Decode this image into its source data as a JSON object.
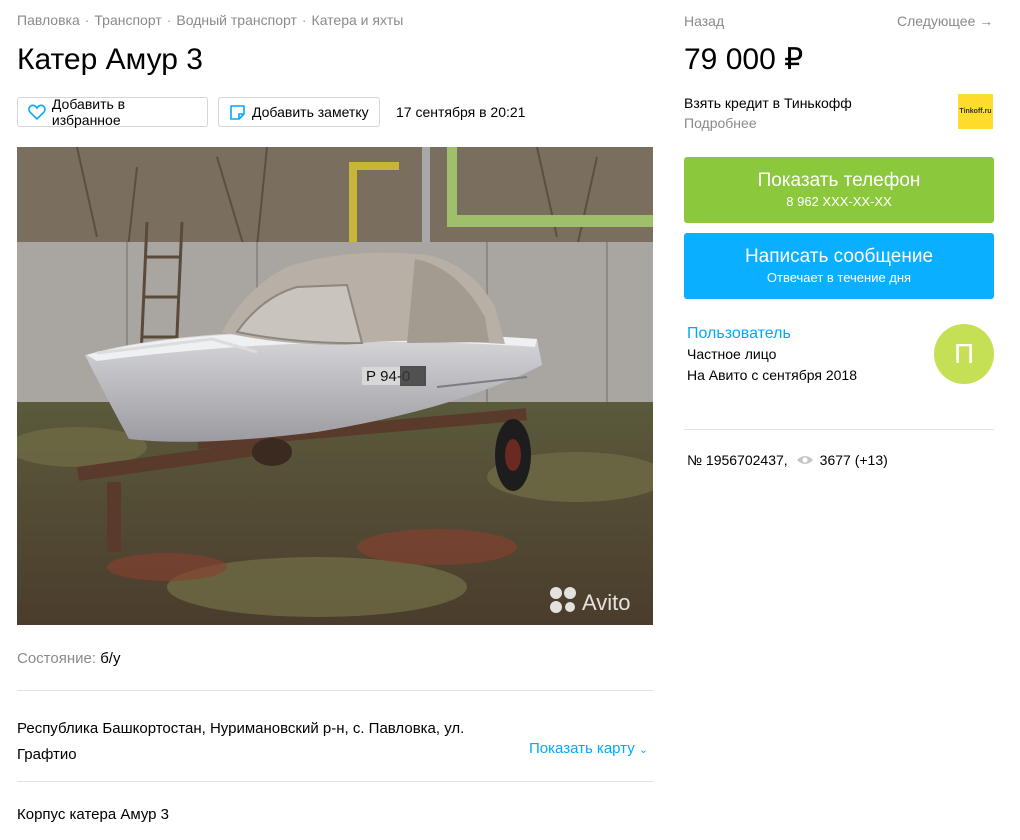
{
  "breadcrumbs": [
    "Павловка",
    "Транспорт",
    "Водный транспорт",
    "Катера и яхты"
  ],
  "breadcrumb_separator": "·",
  "title": "Катер Амур 3",
  "actions": {
    "favorite_label": "Добавить в избранное",
    "note_label": "Добавить заметку",
    "date": "17 сентября в 20:21"
  },
  "photo": {
    "plate_text": "Р 94-0",
    "watermark": "Avito"
  },
  "condition": {
    "label": "Состояние:",
    "value": "б/у"
  },
  "address": {
    "text": "Республика Башкортостан, Нуримановский р-н, с. Павловка, ул. Графтио",
    "show_map": "Показать карту"
  },
  "description": "Корпус катера Амур 3",
  "nav": {
    "back": "Назад",
    "next": "Следующее →"
  },
  "price": "79 000 ₽",
  "credit": {
    "title": "Взять кредит в Тинькофф",
    "more": "Подробнее",
    "logo_text": "Tinkoff.ru"
  },
  "phone_button": {
    "title": "Показать телефон",
    "subtitle": "8 962 XXX-XX-XX",
    "color": "#8cc83c"
  },
  "message_button": {
    "title": "Написать сообщение",
    "subtitle": "Отвечает в течение дня",
    "color": "#0aafff"
  },
  "seller": {
    "name": "Пользователь",
    "type": "Частное лицо",
    "since": "На Авито с сентября 2018",
    "avatar_letter": "П",
    "avatar_color": "#c6e055"
  },
  "listing": {
    "number": "№ 1956702437,",
    "views": "3677 (+13)",
    "views_icon": "eye-icon"
  },
  "colors": {
    "accent_link": "#00aaff",
    "muted_text": "#8a8a8a"
  }
}
